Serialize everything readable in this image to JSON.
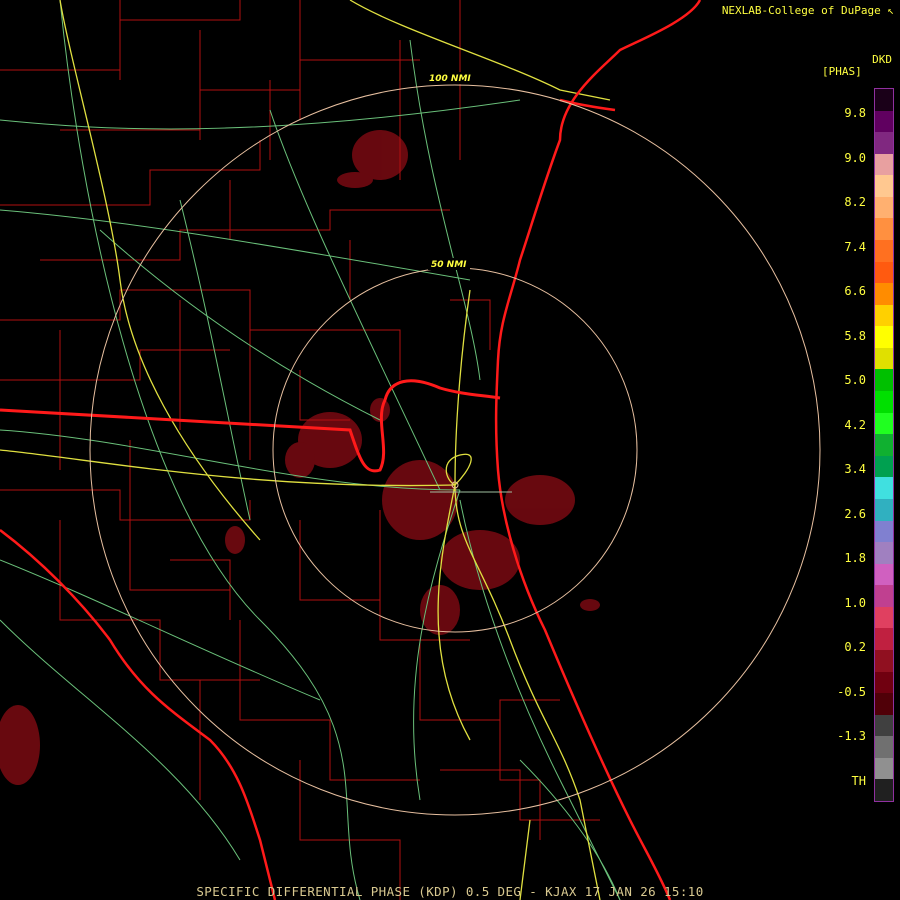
{
  "header": {
    "credit": "NEXLAB-College of DuPage ↖"
  },
  "rings": [
    {
      "label": "100 NMI",
      "range_nmi": 100
    },
    {
      "label": "50 NMI",
      "range_nmi": 50
    }
  ],
  "color_scale": {
    "product": "DKD",
    "unit": "[PHAS]",
    "labels": [
      "9.8",
      "9.0",
      "8.2",
      "7.4",
      "6.6",
      "5.8",
      "5.0",
      "4.2",
      "3.4",
      "2.6",
      "1.8",
      "1.0",
      "0.2",
      "-0.5",
      "-1.3",
      "TH"
    ],
    "colors": [
      "#1a0018",
      "#600060",
      "#802880",
      "#e8a0a0",
      "#ffc890",
      "#ffb070",
      "#ff9040",
      "#ff7020",
      "#ff5a10",
      "#ff8c00",
      "#ffd000",
      "#ffff00",
      "#e0e000",
      "#00c000",
      "#00e000",
      "#20ff20",
      "#10b030",
      "#00a050",
      "#40e0e0",
      "#30b0c0",
      "#8080d0",
      "#a080c0",
      "#d060c0",
      "#c04090",
      "#e04060",
      "#c02040",
      "#901020",
      "#700010",
      "#500008",
      "#404040",
      "#707070",
      "#909090",
      "#202020"
    ]
  },
  "footer": {
    "text": "SPECIFIC DIFFERENTIAL PHASE (KDP) 0.5 DEG - KJAX 17 JAN 26 15:10"
  }
}
